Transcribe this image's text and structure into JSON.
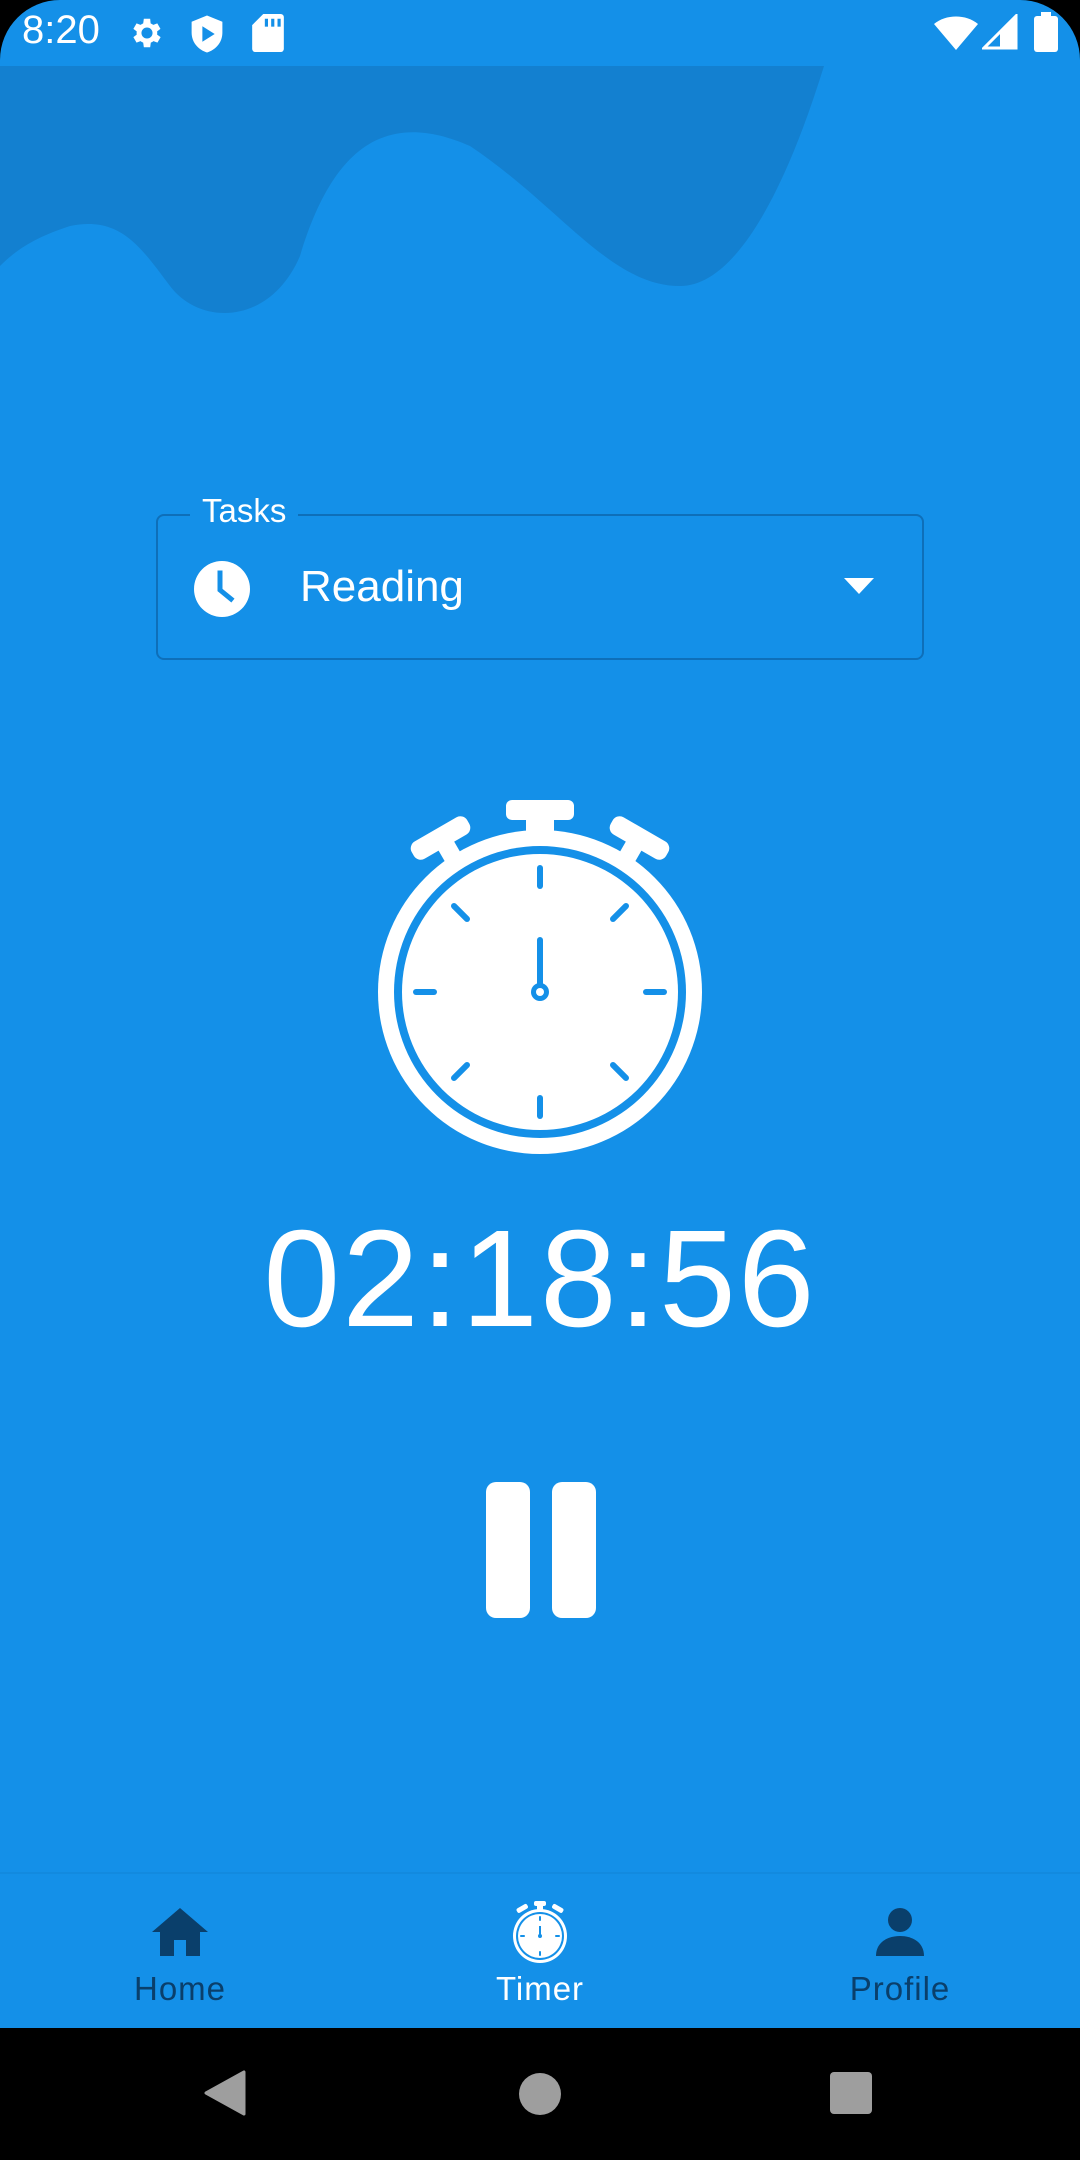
{
  "status_bar": {
    "time": "8:20",
    "icons": [
      "gear-icon",
      "shield-play-icon",
      "sd-card-icon",
      "wifi-icon",
      "signal-icon",
      "battery-icon"
    ]
  },
  "tasks": {
    "legend": "Tasks",
    "selected": "Reading",
    "icon": "clock-icon"
  },
  "timer": {
    "display": "02:18:56",
    "state": "running"
  },
  "bottom_nav": {
    "items": [
      {
        "label": "Home",
        "icon": "home-icon",
        "active": false
      },
      {
        "label": "Timer",
        "icon": "stopwatch-icon",
        "active": true
      },
      {
        "label": "Profile",
        "icon": "person-icon",
        "active": false
      }
    ]
  },
  "colors": {
    "background": "#1490E8",
    "wave": "#1380D0",
    "nav_inactive": "#0A3F6B",
    "foreground": "#FFFFFF"
  }
}
